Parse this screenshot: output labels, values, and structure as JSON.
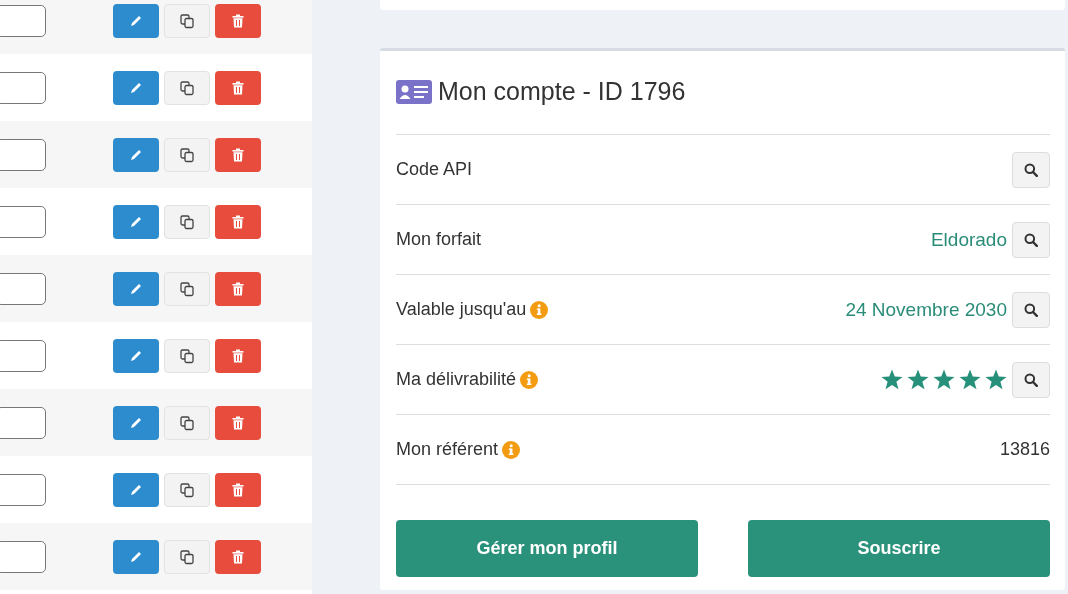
{
  "table": {
    "rows": [
      {
        "actions": [
          {
            "kind": "edit"
          },
          {
            "kind": "copy"
          },
          {
            "kind": "delete"
          }
        ]
      },
      {
        "actions": [
          {
            "kind": "edit"
          },
          {
            "kind": "copy"
          },
          {
            "kind": "delete"
          }
        ]
      },
      {
        "actions": [
          {
            "kind": "edit"
          },
          {
            "kind": "copy"
          },
          {
            "kind": "delete"
          }
        ]
      },
      {
        "actions": [
          {
            "kind": "edit"
          },
          {
            "kind": "copy"
          },
          {
            "kind": "delete"
          }
        ]
      },
      {
        "actions": [
          {
            "kind": "edit"
          },
          {
            "kind": "copy"
          },
          {
            "kind": "delete"
          }
        ]
      },
      {
        "actions": [
          {
            "kind": "edit"
          },
          {
            "kind": "copy"
          },
          {
            "kind": "delete"
          }
        ]
      },
      {
        "actions": [
          {
            "kind": "edit"
          },
          {
            "kind": "copy"
          },
          {
            "kind": "delete"
          }
        ]
      },
      {
        "actions": [
          {
            "kind": "edit"
          },
          {
            "kind": "copy"
          },
          {
            "kind": "delete"
          }
        ]
      },
      {
        "actions": [
          {
            "kind": "edit"
          },
          {
            "kind": "copy"
          },
          {
            "kind": "delete"
          }
        ]
      }
    ]
  },
  "account": {
    "title": "Mon compte - ID 1796",
    "rows": [
      {
        "kind": "text",
        "label": "Code API",
        "info": false,
        "search": true
      },
      {
        "kind": "text",
        "label": "Mon forfait",
        "info": false,
        "value": "Eldorado",
        "search": true
      },
      {
        "kind": "text",
        "label": "Valable jusqu'au",
        "info": true,
        "value": "24 Novembre 2030",
        "search": true
      },
      {
        "kind": "stars",
        "label": "Ma délivrabilité",
        "info": true,
        "stars": 5,
        "search": true
      },
      {
        "kind": "plain",
        "label": "Mon référent",
        "info": true,
        "value": "13816",
        "search": false
      }
    ],
    "buttons": [
      "Gérer mon profil",
      "Souscrire"
    ]
  }
}
